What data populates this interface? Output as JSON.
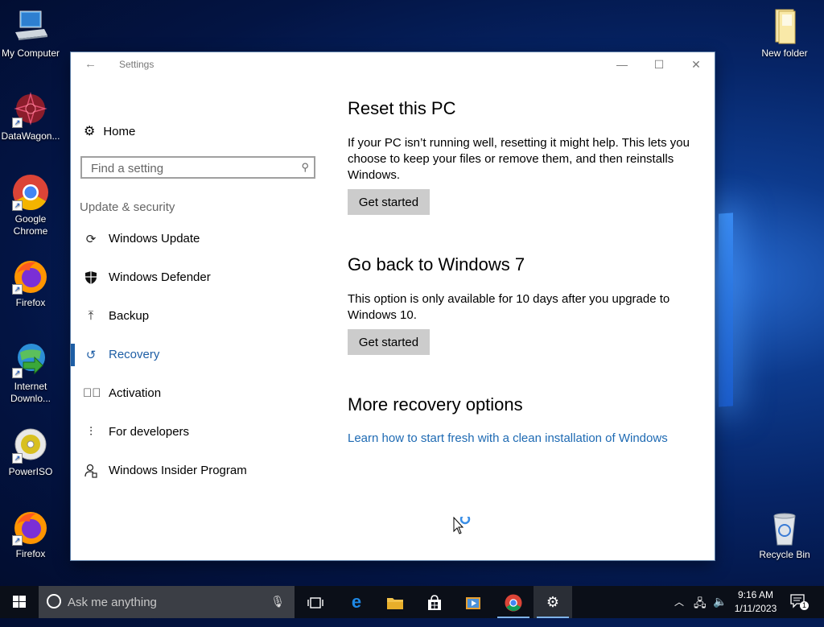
{
  "desktop": {
    "icons": [
      {
        "label": "My Computer",
        "icon": "computer-icon"
      },
      {
        "label": "DataWagon...",
        "icon": "datawagon-icon"
      },
      {
        "label": "Google Chrome",
        "icon": "chrome-icon"
      },
      {
        "label": "Firefox",
        "icon": "firefox-icon"
      },
      {
        "label": "Internet Downlo...",
        "icon": "idm-icon"
      },
      {
        "label": "PowerISO",
        "icon": "poweriso-icon"
      },
      {
        "label": "Firefox",
        "icon": "firefox-icon"
      },
      {
        "label": "New folder",
        "icon": "folder-icon"
      },
      {
        "label": "Recycle Bin",
        "icon": "recycle-bin-icon"
      }
    ]
  },
  "window": {
    "title": "Settings",
    "back_glyph": "←",
    "min_glyph": "—",
    "max_glyph": "☐",
    "close_glyph": "✕"
  },
  "nav": {
    "home": "Home",
    "search_placeholder": "Find a setting",
    "section": "Update & security",
    "items": [
      {
        "label": "Windows Update",
        "icon": "sync-icon"
      },
      {
        "label": "Windows Defender",
        "icon": "shield-icon"
      },
      {
        "label": "Backup",
        "icon": "backup-arrow-icon"
      },
      {
        "label": "Recovery",
        "icon": "history-icon"
      },
      {
        "label": "Activation",
        "icon": "check-circle-icon"
      },
      {
        "label": "For developers",
        "icon": "tools-icon"
      },
      {
        "label": "Windows Insider Program",
        "icon": "insider-icon"
      }
    ]
  },
  "content": {
    "reset": {
      "title": "Reset this PC",
      "text": "If your PC isn’t running well, resetting it might help. This lets you choose to keep your files or remove them, and then reinstalls Windows.",
      "button": "Get started"
    },
    "goback": {
      "title": "Go back to Windows 7",
      "text": "This option is only available for 10 days after you upgrade to Windows 10.",
      "button": "Get started"
    },
    "more": {
      "title": "More recovery options",
      "link": "Learn how to start fresh with a clean installation of Windows"
    }
  },
  "taskbar": {
    "search_text": "Ask me anything",
    "time": "9:16 AM",
    "date": "1/11/2023",
    "notification_count": "1"
  },
  "colors": {
    "accent": "#1e5ea5",
    "link": "#1e6ab3",
    "button_bg": "#cccccc"
  }
}
